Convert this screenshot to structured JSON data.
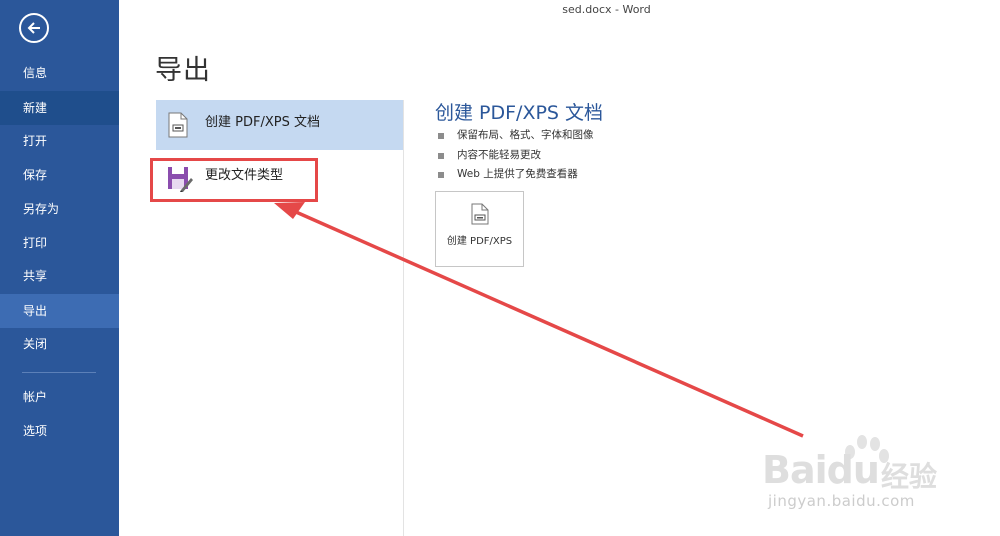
{
  "window": {
    "title": "sed.docx - Word"
  },
  "sidebar": {
    "back_icon": "back-arrow-icon",
    "items": [
      {
        "label": "信息"
      },
      {
        "label": "新建"
      },
      {
        "label": "打开"
      },
      {
        "label": "保存"
      },
      {
        "label": "另存为"
      },
      {
        "label": "打印"
      },
      {
        "label": "共享"
      },
      {
        "label": "导出"
      },
      {
        "label": "关闭"
      },
      {
        "label": "帐户"
      },
      {
        "label": "选项"
      }
    ],
    "active_item": "导出"
  },
  "main": {
    "title": "导出",
    "options": [
      {
        "label": "创建 PDF/XPS 文档",
        "icon": "pdf-document-icon",
        "selected": true
      },
      {
        "label": "更改文件类型",
        "icon": "save-file-type-icon",
        "selected": false
      }
    ],
    "detail": {
      "title": "创建 PDF/XPS 文档",
      "bullets": [
        "保留布局、格式、字体和图像",
        "内容不能轻易更改",
        "Web 上提供了免费查看器"
      ],
      "button_label": "创建 PDF/XPS",
      "button_icon": "pdf-document-icon"
    }
  },
  "annotation": {
    "color": "#e54848"
  },
  "watermark": {
    "brand": "Bai",
    "brand2": "du",
    "cn": "经验",
    "url": "jingyan.baidu.com"
  },
  "colors": {
    "sidebar": "#2b579a",
    "sidebar_active": "#3d6cb3",
    "selected_option": "#c5d9f1",
    "accent": "#2b579a"
  }
}
